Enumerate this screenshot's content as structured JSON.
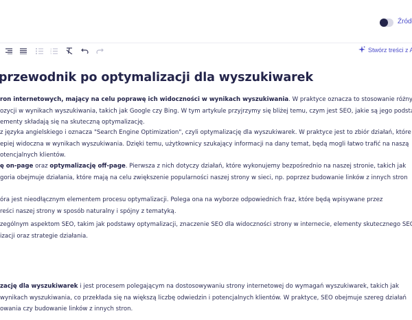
{
  "header": {
    "source_toggle_label": "Źródł"
  },
  "toolbar": {
    "buttons": [
      "align-right-icon",
      "align-justify-icon",
      "bullet-list-icon",
      "numbered-list-icon",
      "clear-format-icon",
      "undo-icon",
      "redo-icon"
    ],
    "ai_label": "Stwórz treści z A"
  },
  "article": {
    "title": "przewodnik po optymalizacji dla wyszukiwarek",
    "p1": {
      "l1_bold": "ron internetowych, mający na celu poprawę ich widoczności w wynikach wyszukiwania",
      "l1_rest": ". W praktyce oznacza to stosowanie różnych",
      "l2": "ozycji w wynikach wyszukiwania, takich jak Google czy Bing. W tym artykule przyjrzymy się bliżej temu, czym jest SEO, jakie są jego podstawy",
      "l3": "ementy składają się na skuteczną optymalizację."
    },
    "p2": {
      "l1": "z języka angielskiego i oznacza \"Search Engine Optimization\", czyli optymalizację dla wyszukiwarek. W praktyce jest to zbiór działań, które",
      "l2": "epiej widoczna w wynikach wyszukiwania. Dzięki temu, użytkownicy szukający informacji na dany temat, będą mogli łatwo trafić na naszą",
      "l3": "otencjalnych klientów."
    },
    "p3": {
      "l1_bold1": "ę on-page",
      "l1_mid": " oraz ",
      "l1_bold2": "optymalizację off-page",
      "l1_rest": ". Pierwsza z nich dotyczy działań, które wykonujemy bezpośrednio na naszej stronie, takich jak",
      "l2": "goria obejmuje działania, które mają na celu zwiększenie popularności naszej strony w sieci, np. poprzez budowanie linków z innych stron"
    },
    "p4": {
      "l1": "óra jest nieodłącznym elementem procesu optymalizacji. Polega ona na wyborze odpowiednich fraz, które będą wpisywane przez",
      "l2": "reści naszej strony w sposób naturalny i spójny z tematyką."
    },
    "p5": {
      "l1": "zególnym aspektom SEO, takim jak podstawy optymalizacji, znaczenie SEO dla widoczności strony w internecie, elementy skutecznego SEO",
      "l2": "izacji oraz strategie działania."
    },
    "p6": {
      "l1_bold": "zację dla wyszukiwarek",
      "l1_rest": " i jest procesem polegającym na dostosowywaniu strony internetowej do wymagań wyszukiwarek, takich jak",
      "l2": "wynikach wyszukiwania, co przekłada się na większą liczbę odwiedzin i potencjalnych klientów. W praktyce, SEO obejmuje szereg działań",
      "l3": "owania czy budowanie linków z innych stron."
    }
  }
}
